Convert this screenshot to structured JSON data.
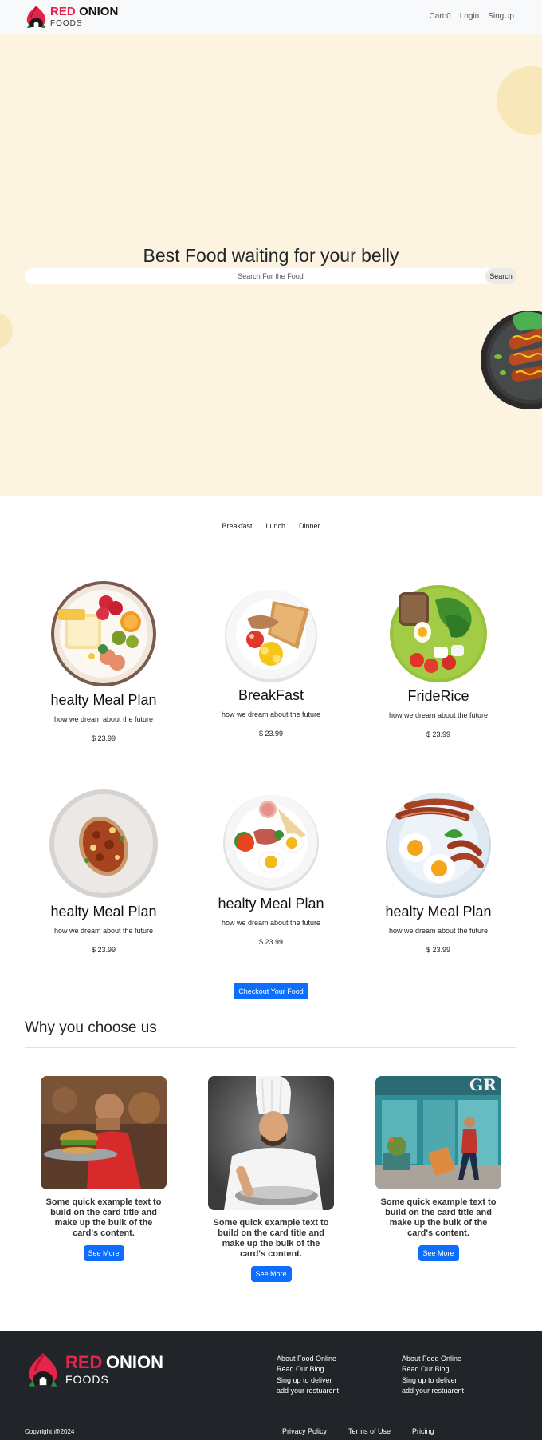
{
  "brand": {
    "red": "RED",
    "name": "ONION",
    "sub": "FOODS"
  },
  "nav": {
    "cart": "Cart:0",
    "login": "Login",
    "signup": "SingUp"
  },
  "hero": {
    "title": "Best Food waiting for your belly",
    "search_placeholder": "Search For the Food",
    "search_button": "Search"
  },
  "tabs": [
    "Breakfast",
    "Lunch",
    "Dinner"
  ],
  "foods": [
    {
      "title": "healty Meal Plan",
      "desc": "how we dream about the future",
      "price": "$ 23.99"
    },
    {
      "title": "BreakFast",
      "desc": "how we dream about the future",
      "price": "$ 23.99"
    },
    {
      "title": "FrideRice",
      "desc": "how we dream about the future",
      "price": "$ 23.99"
    },
    {
      "title": "healty Meal Plan",
      "desc": "how we dream about the future",
      "price": "$ 23.99"
    },
    {
      "title": "healty Meal Plan",
      "desc": "how we dream about the future",
      "price": "$ 23.99"
    },
    {
      "title": "healty Meal Plan",
      "desc": "how we dream about the future",
      "price": "$ 23.99"
    }
  ],
  "checkout_label": "Checkout Your Food",
  "why": {
    "title": "Why you choose us",
    "cards": [
      {
        "text": "Some quick example text to build on the card title and make up the bulk of the card's content.",
        "button": "See More"
      },
      {
        "text": "Some quick example text to build on the card title and make up the bulk of the card's content.",
        "button": "See More"
      },
      {
        "text": "Some quick example text to build on the card title and make up the bulk of the card's content.",
        "button": "See More"
      }
    ]
  },
  "footer": {
    "col1": [
      "About Food Online",
      "Read Our Blog",
      "Sing up to deliver",
      "add your restuarent"
    ],
    "col2": [
      "About Food Online",
      "Read Our Blog",
      "Sing up to deliver",
      "add your restuarent"
    ],
    "copyright": "Copyright @2024",
    "links": [
      "Privacy Policy",
      "Terms of Use",
      "Pricing"
    ]
  },
  "colors": {
    "brand_red": "#e4244b",
    "primary": "#0d6efd",
    "hero_bg": "#fdf3e1",
    "footer_bg": "#212529"
  }
}
